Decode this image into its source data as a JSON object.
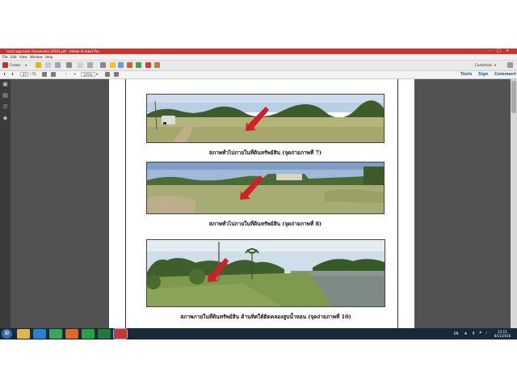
{
  "window": {
    "title": "Land appraisal (Suwandee 2016).pdf - Adobe Acrobat Pro",
    "controls": {
      "minimize": "–",
      "maximize": "□",
      "close": "✕"
    }
  },
  "menu": [
    "File",
    "Edit",
    "View",
    "Window",
    "Help"
  ],
  "toolbar": {
    "create_label": "Create",
    "customize_label": "Customize"
  },
  "nav": {
    "current_page": "47",
    "total_pages": "/ 72",
    "zoom": "125%"
  },
  "panes": {
    "tools": "Tools",
    "sign": "Sign",
    "comment": "Comment"
  },
  "document": {
    "photos": [
      {
        "caption": "สภาพทั่วไปภายในที่ดินทรัพย์สิน (จุดถ่ายภาพที่ 7)"
      },
      {
        "caption": "สภาพทั่วไปภายในที่ดินทรัพย์สิน (จุดถ่ายภาพที่ 8)"
      },
      {
        "caption": "สภาพภายในที่ดินทรัพย์สิน ด้านทิศใต้ติดคลองสูบน้ำหอน (จุดถ่ายภาพที่ 10)"
      }
    ]
  },
  "taskbar": {
    "language": "EN",
    "time": "13:11",
    "date": "8/11/2016"
  },
  "colors": {
    "title_bar": "#c8372f",
    "taskbar": "#18293a",
    "arrow": "#d21d2a",
    "pane_link": "#2f5f98"
  }
}
